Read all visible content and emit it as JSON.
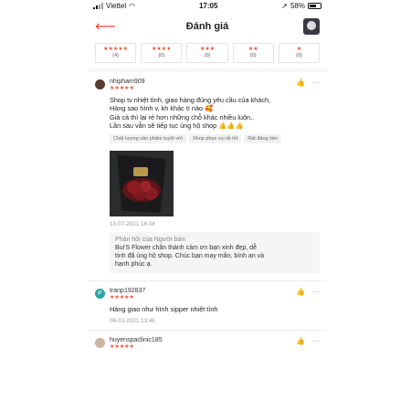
{
  "statusbar": {
    "carrier": "Viettel",
    "time": "17:05",
    "battery": "58%"
  },
  "header": {
    "title": "Đánh giá"
  },
  "filters": [
    {
      "stars": "★★★★★",
      "count": "(4)"
    },
    {
      "stars": "★★★★",
      "count": "(0)"
    },
    {
      "stars": "★★★",
      "count": "(0)"
    },
    {
      "stars": "★★",
      "count": "(0)"
    },
    {
      "stars": "★",
      "count": "(0)"
    }
  ],
  "reviews": [
    {
      "username": "nhipham909",
      "stars": "★★★★★",
      "text_lines": [
        "Shop tv nhiệt tình, giao hàng đúng yêu cầu của khách,",
        "Hàng sao hình v, kh khác tí nào 🥰",
        "Giá cả thì lại rẻ hơn những chỗ khác nhiều luôn..",
        "Lần sau vẫn sẽ tiếp tục ủng hộ shop 👍👍👍"
      ],
      "tags": [
        "Chất lượng sản phẩm tuyệt vời",
        "Shop phục vụ rất tốt",
        "Rất đáng tiền"
      ],
      "date": "13-07-2021 16:04",
      "seller_reply": {
        "title": "Phản hồi của Người bán:",
        "lines": [
          "Bui'S Flower chân thành cảm ơn bạn xinh đẹp, dễ",
          "tính đã ủng hộ shop. Chúc bạn may mắn, bình an và",
          "hạnh phúc ạ."
        ]
      }
    },
    {
      "username": "tranp192837",
      "avatar_letter": "P",
      "stars": "★★★★★",
      "text": "Hàng giao như hình sipper nhiệt tình",
      "date": "06-03-2021 13:46"
    },
    {
      "username": "huyenspaclinic185",
      "stars": "★★★★★"
    }
  ],
  "colors": {
    "accent": "#ee4d2d"
  }
}
